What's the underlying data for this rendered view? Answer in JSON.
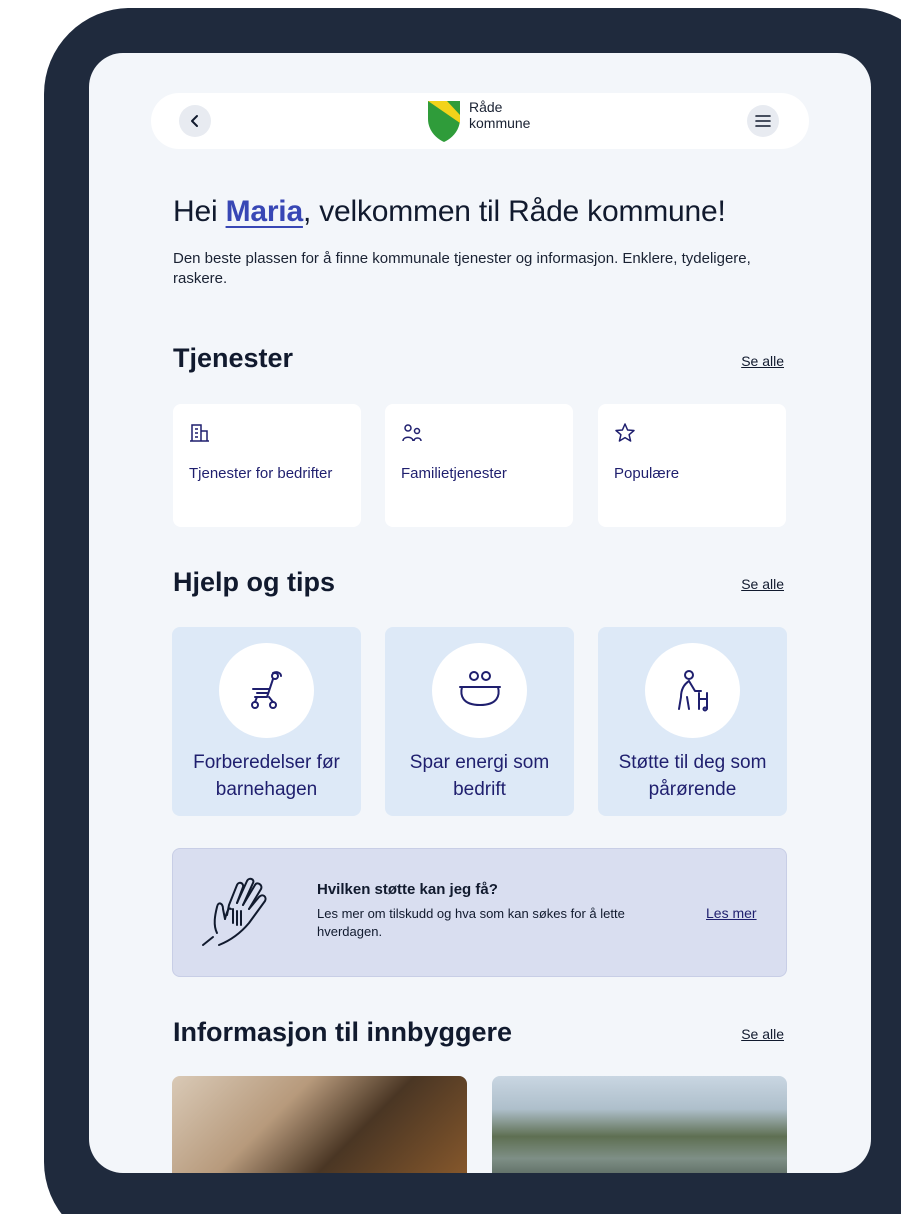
{
  "header": {
    "logo_line1": "Råde",
    "logo_line2": "kommune",
    "back_icon": "chevron-left-icon",
    "menu_icon": "hamburger-menu-icon"
  },
  "hero": {
    "greeting_prefix": "Hei ",
    "user_name": "Maria",
    "greeting_suffix": ", velkommen til Råde kommune!",
    "description": "Den beste plassen for å finne kommunale tjenester og informasjon. Enklere, tydeligere, raskere."
  },
  "services": {
    "title": "Tjenester",
    "see_all": "Se alle",
    "items": [
      {
        "label": "Tjenester for bedrifter",
        "icon": "building-icon"
      },
      {
        "label": "Familietjenester",
        "icon": "people-icon"
      },
      {
        "label": "Populære",
        "icon": "star-icon"
      }
    ]
  },
  "help": {
    "title": "Hjelp og tips",
    "see_all": "Se alle",
    "items": [
      {
        "label": "Forberedelser før barnehagen",
        "icon": "stroller-icon"
      },
      {
        "label": "Spar energi som bedrift",
        "icon": "money-bag-icon"
      },
      {
        "label": "Støtte til deg som pårørende",
        "icon": "elderly-walker-icon"
      }
    ]
  },
  "support_banner": {
    "title": "Hvilken støtte kan jeg få?",
    "text": "Les mer om tilskudd og hva som kan søkes for å lette hverdagen.",
    "link": "Les mer",
    "icon": "helping-hands-icon"
  },
  "info": {
    "title": "Informasjon til innbyggere",
    "see_all": "Se alle"
  },
  "colors": {
    "device_frame": "#1f2a3d",
    "screen_bg": "#f3f6fa",
    "accent": "#3847b5",
    "card_text": "#1f1f6e",
    "help_card_bg": "#dde9f7",
    "banner_bg": "#d9def0"
  }
}
